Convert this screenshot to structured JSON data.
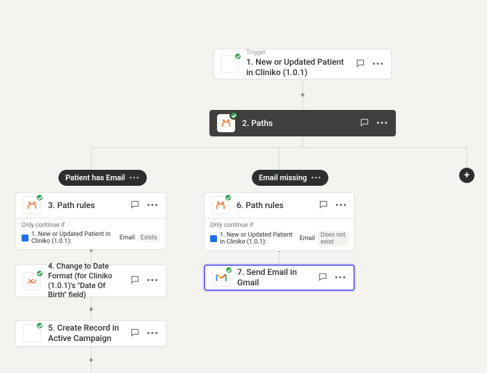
{
  "trigger": {
    "label": "Trigger",
    "title": "1. New or Updated Patient in Cliniko (1.0.1)"
  },
  "paths_node": {
    "title": "2. Paths"
  },
  "path_a": {
    "chip": "Patient has Email",
    "rules_title": "3. Path rules",
    "only": "Only continue if",
    "ref": "1. New or Updated Patient in Cliniko (1.0.1):",
    "field": "Email",
    "cond": "Exists",
    "step2": "4. Change to Date Format (for Cliniko (1.0.1)'s \"Date Of Birth\" field)",
    "step3": "5. Create Record in Active Campaign"
  },
  "path_b": {
    "chip": "Email missing",
    "rules_title": "6. Path rules",
    "only": "Only continue if",
    "ref": "1. New or Updated Patient in Cliniko (1.0.1):",
    "field": "Email",
    "cond": "Does not exist",
    "step2": "7. Send Email in Gmail"
  }
}
